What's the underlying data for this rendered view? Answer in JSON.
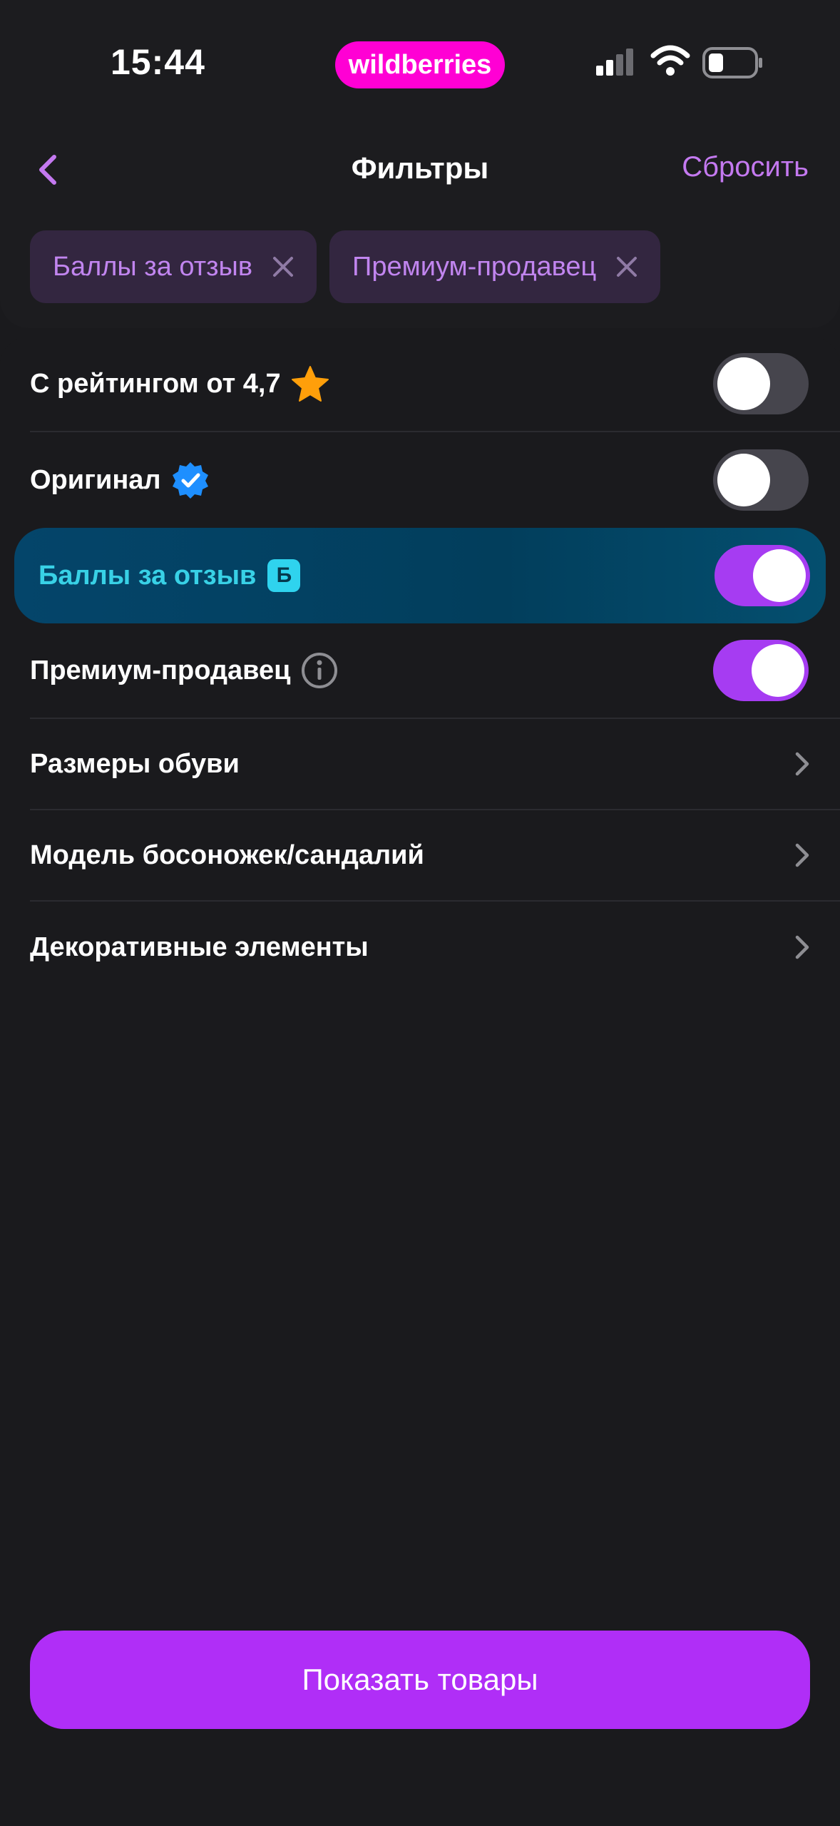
{
  "status_bar": {
    "time": "15:44",
    "brand": "wildberries",
    "brand_color": "#ff00d4"
  },
  "header": {
    "title": "Фильтры",
    "reset_label": "Сбросить",
    "back_icon": "chevron-left-icon"
  },
  "active_chips": [
    {
      "label": "Баллы за отзыв"
    },
    {
      "label": "Премиум-продавец"
    }
  ],
  "filters": {
    "rating": {
      "label": "С рейтингом от 4,7",
      "icon": "star-icon",
      "enabled": false
    },
    "original": {
      "label": "Оригинал",
      "icon": "verified-badge-icon",
      "enabled": false
    },
    "review_points": {
      "label": "Баллы за отзыв",
      "badge": "Б",
      "enabled": true
    },
    "premium_seller": {
      "label": "Премиум-продавец",
      "icon": "info-icon",
      "enabled": true
    }
  },
  "categories": [
    {
      "label": "Размеры обуви"
    },
    {
      "label": "Модель босоножек/сандалий"
    },
    {
      "label": "Декоративные элементы"
    }
  ],
  "footer": {
    "show_button_label": "Показать товары"
  },
  "colors": {
    "accent": "#a63cf2",
    "highlight_text": "#38d1e6",
    "background": "#1a1a1d"
  }
}
